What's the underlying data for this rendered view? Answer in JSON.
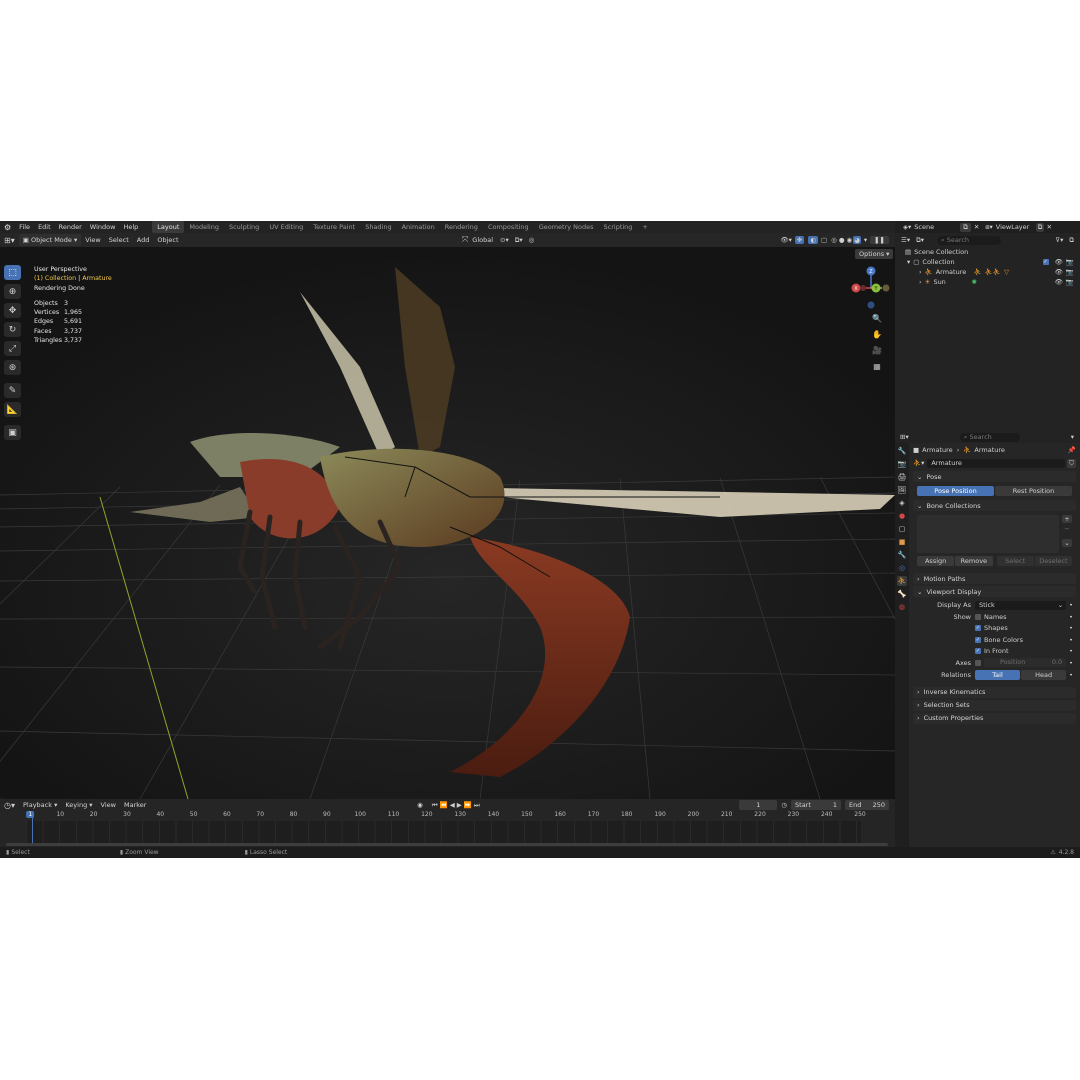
{
  "menu": [
    "File",
    "Edit",
    "Render",
    "Window",
    "Help"
  ],
  "workspaces": [
    "Layout",
    "Modeling",
    "Sculpting",
    "UV Editing",
    "Texture Paint",
    "Shading",
    "Animation",
    "Rendering",
    "Compositing",
    "Geometry Nodes",
    "Scripting"
  ],
  "active_workspace": "Layout",
  "add_workspace": "+",
  "header": {
    "mode": "Object Mode",
    "view": "View",
    "select": "Select",
    "add": "Add",
    "object": "Object",
    "transform": "Global",
    "options": "Options"
  },
  "overlay": {
    "perspective": "User Perspective",
    "collection": "(1) Collection",
    "separator": "|",
    "active": "Armature",
    "status": "Rendering Done",
    "stats": [
      {
        "label": "Objects",
        "value": "3"
      },
      {
        "label": "Vertices",
        "value": "1,965"
      },
      {
        "label": "Edges",
        "value": "5,691"
      },
      {
        "label": "Faces",
        "value": "3,737"
      },
      {
        "label": "Triangles",
        "value": "3,737"
      }
    ]
  },
  "gizmo": {
    "z": "Z",
    "y": "Y",
    "x": "X"
  },
  "timeline": {
    "playback": "Playback",
    "keying": "Keying",
    "view": "View",
    "marker": "Marker",
    "current_frame": "1",
    "start_label": "Start",
    "start": "1",
    "end_label": "End",
    "end": "250",
    "ticks": [
      "1",
      "10",
      "20",
      "30",
      "40",
      "50",
      "60",
      "70",
      "80",
      "90",
      "100",
      "110",
      "120",
      "130",
      "140",
      "150",
      "160",
      "170",
      "180",
      "190",
      "200",
      "210",
      "220",
      "230",
      "240",
      "250"
    ]
  },
  "statusbar": {
    "select": "Select",
    "zoom": "Zoom View",
    "lasso": "Lasso Select",
    "version": "4.2.8"
  },
  "outliner": {
    "scene": "Scene",
    "view_layer": "ViewLayer",
    "search_placeholder": "Search",
    "root": "Scene Collection",
    "collection": "Collection",
    "items": [
      "Armature",
      "Sun"
    ]
  },
  "properties": {
    "search_placeholder": "Search",
    "breadcrumb": [
      "Armature",
      "Armature"
    ],
    "data_name": "Armature",
    "pose": {
      "title": "Pose",
      "pose_position": "Pose Position",
      "rest_position": "Rest Position"
    },
    "bone_collections": {
      "title": "Bone Collections",
      "assign": "Assign",
      "remove": "Remove",
      "select": "Select",
      "deselect": "Deselect"
    },
    "motion_paths": "Motion Paths",
    "viewport_display": {
      "title": "Viewport Display",
      "display_as_label": "Display As",
      "display_as": "Stick",
      "show_label": "Show",
      "show": [
        {
          "label": "Names",
          "checked": false
        },
        {
          "label": "Shapes",
          "checked": true
        },
        {
          "label": "Bone Colors",
          "checked": true
        },
        {
          "label": "In Front",
          "checked": true
        }
      ],
      "axes_label": "Axes",
      "axes_position_label": "Position",
      "axes_position": "0.0",
      "relations_label": "Relations",
      "tail": "Tail",
      "head": "Head"
    },
    "collapsed": [
      "Inverse Kinematics",
      "Selection Sets",
      "Custom Properties"
    ]
  }
}
